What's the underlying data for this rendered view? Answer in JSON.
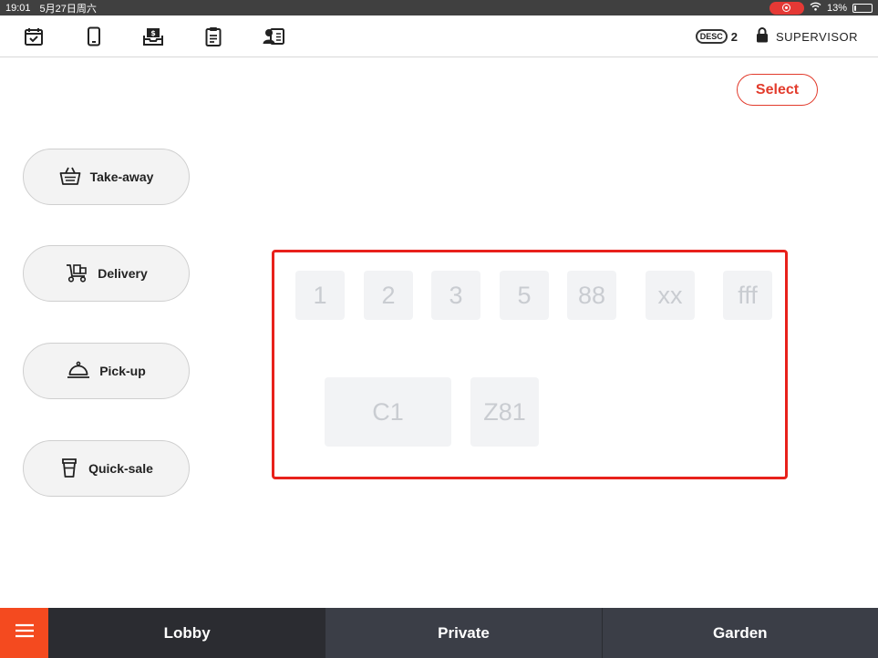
{
  "status_bar": {
    "time": "19:01",
    "date": "5月27日周六",
    "battery": "13%",
    "battery_fraction": 0.13
  },
  "toolbar": {
    "icons": [
      "calendar-check-icon",
      "phone-icon",
      "cash-drawer-icon",
      "clipboard-icon",
      "user-card-icon"
    ],
    "desc_label": "DESC",
    "desc_count": "2",
    "user_role": "SUPERVISOR"
  },
  "select_button": {
    "label": "Select"
  },
  "order_types": [
    {
      "label": "Take-away",
      "icon": "basket-icon"
    },
    {
      "label": "Delivery",
      "icon": "delivery-cart-icon"
    },
    {
      "label": "Pick-up",
      "icon": "service-bell-icon"
    },
    {
      "label": "Quick-sale",
      "icon": "cup-icon"
    }
  ],
  "tables": [
    {
      "label": "1"
    },
    {
      "label": "2"
    },
    {
      "label": "3"
    },
    {
      "label": "5"
    },
    {
      "label": "88"
    },
    {
      "label": "xx"
    },
    {
      "label": "fff"
    },
    {
      "label": "C1"
    },
    {
      "label": "Z81"
    }
  ],
  "bottom_bar": {
    "menu_icon": "hamburger-menu-icon",
    "areas": [
      {
        "label": "Lobby",
        "active": true
      },
      {
        "label": "Private",
        "active": false
      },
      {
        "label": "Garden",
        "active": false
      }
    ]
  },
  "colors": {
    "accent": "#e23b2c",
    "menu_button": "#f44a1f",
    "highlight_frame": "#e8211b",
    "bottom_bar": "#3a3d45"
  }
}
